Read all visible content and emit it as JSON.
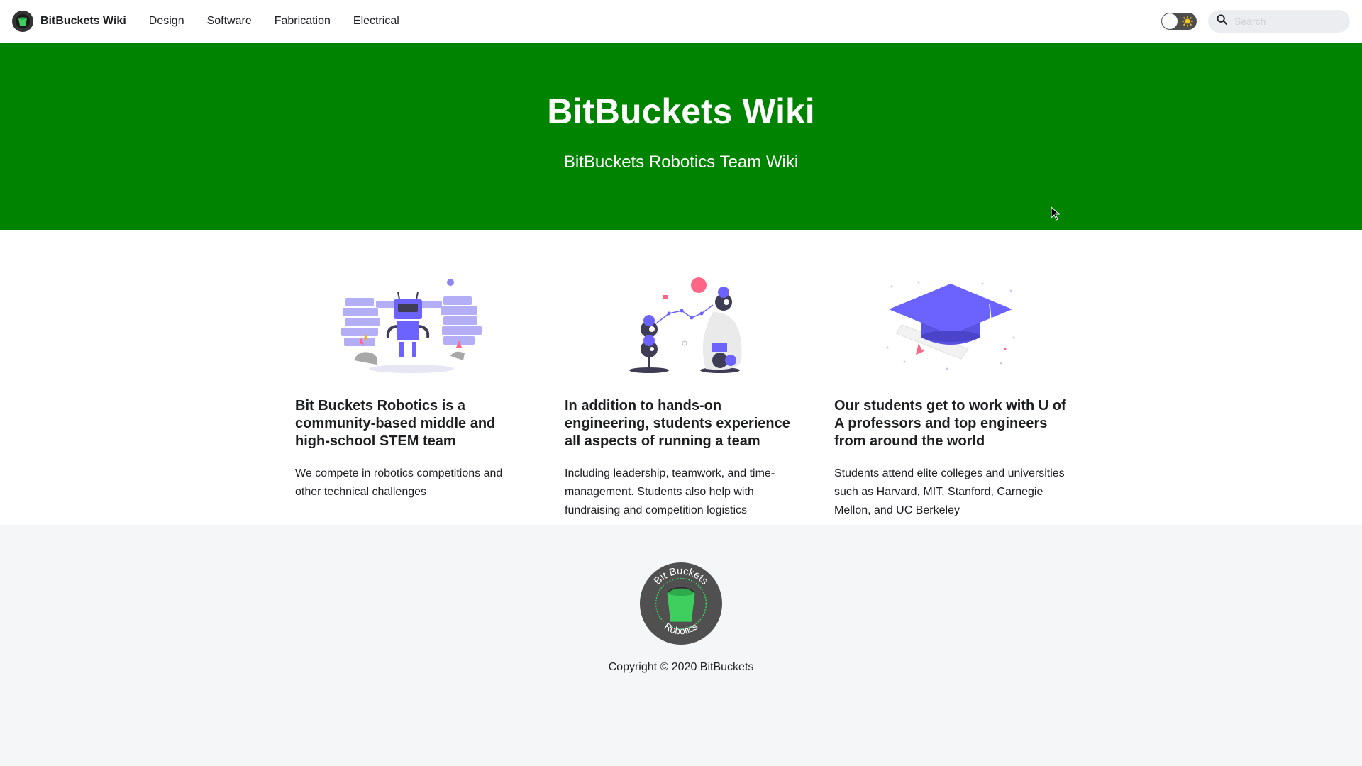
{
  "navbar": {
    "brand_title": "BitBuckets Wiki",
    "links": [
      "Design",
      "Software",
      "Fabrication",
      "Electrical"
    ],
    "search_placeholder": "Search"
  },
  "hero": {
    "title": "BitBuckets Wiki",
    "subtitle": "BitBuckets Robotics Team Wiki"
  },
  "features": [
    {
      "title": "Bit Buckets Robotics is a community-based middle and high-school STEM team",
      "description": "We compete in robotics competitions and other technical challenges"
    },
    {
      "title": "In addition to hands-on engineering, students experience all aspects of running a team",
      "description": "Including leadership, teamwork, and time-management. Students also help with fundraising and competition logistics"
    },
    {
      "title": "Our students get to work with U of A professors and top engineers from around the world",
      "description": "Students attend elite colleges and universities such as Harvard, MIT, Stanford, Carnegie Mellon, and UC Berkeley"
    }
  ],
  "footer": {
    "logo_text_top": "Bit Buckets",
    "logo_text_bottom": "Robotics",
    "copyright": "Copyright © 2020 BitBuckets"
  },
  "colors": {
    "hero_green": "#008400",
    "accent_purple": "#6c63ff",
    "footer_bg": "#f5f6f7",
    "bucket_green": "#3ecf5f"
  }
}
